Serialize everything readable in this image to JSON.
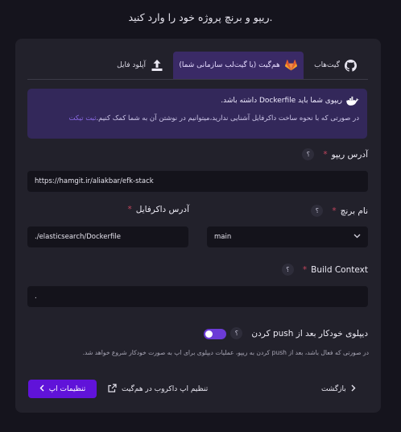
{
  "heading": "ریپو و برنچ پروژه خود را وارد کنید.",
  "tabs": [
    {
      "label": "گیت‌هاب",
      "icon": "github-icon"
    },
    {
      "label": "هم‌گیت (یا گیت‌لب سازمانی شما)",
      "icon": "gitlab-icon"
    },
    {
      "label": "آپلود فایل",
      "icon": "upload-icon"
    }
  ],
  "alert": {
    "line1": "ریپوی شما باید Dockerfile داشته باشد.",
    "line2": "در صورتی که با نحوه ساخت داکرفایل آشنایی ندارید،میتوانیم در نوشتن آن به شما کمک کنیم.",
    "link": "ثبت تیکت"
  },
  "fields": {
    "repo": {
      "label": "آدرس ریپو",
      "value": "https://hamgit.ir/aliakbar/efk-stack"
    },
    "branch": {
      "label": "نام برنچ",
      "value": "main"
    },
    "dockerfile": {
      "label": "آدرس داکرفایل",
      "value": "./elasticsearch/Dockerfile"
    },
    "context": {
      "label": "Build Context",
      "value": "."
    }
  },
  "help_mark": "؟",
  "required_mark": "*",
  "auto_deploy": {
    "label": "دیپلوی خودکار بعد از push کردن",
    "note": "در صورتی که فعال باشد، بعد از push کردن به ریپو، عملیات دیپلوی برای اپ به صورت خودکار شروع خواهد شد.",
    "enabled": false
  },
  "buttons": {
    "back": "بازگشت",
    "webhook": "تنظیم اپ داکروب در هم‌گیت",
    "settings": "تنظیمات اپ"
  },
  "colors": {
    "accent": "#6013d9",
    "alert_bg": "#33285a",
    "tab_active_bg": "#3a2a66"
  }
}
